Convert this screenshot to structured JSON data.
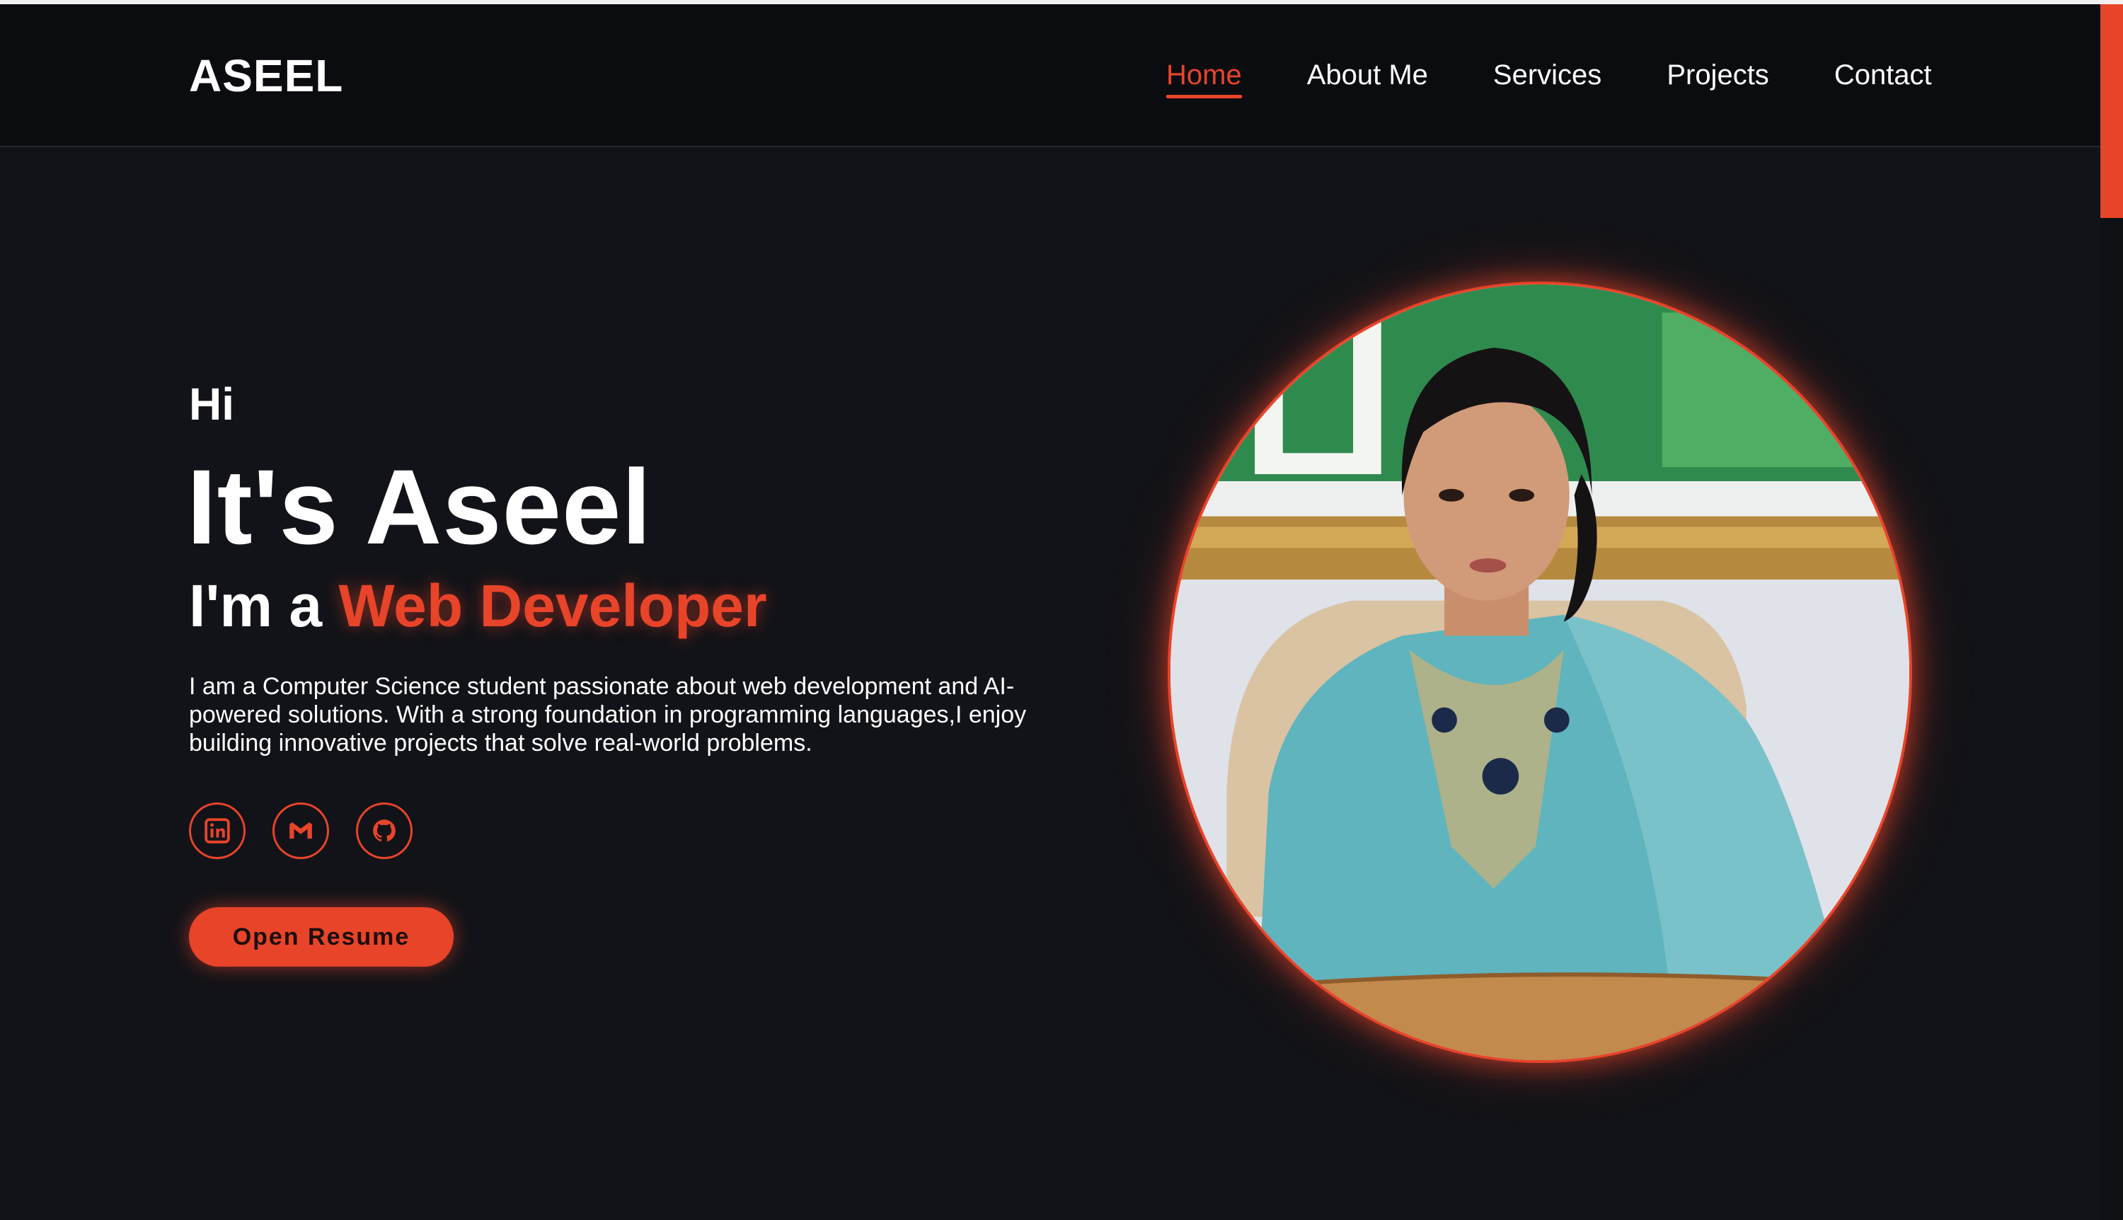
{
  "header": {
    "logo": "ASEEL",
    "nav": [
      {
        "label": "Home",
        "active": true
      },
      {
        "label": "About Me",
        "active": false
      },
      {
        "label": "Services",
        "active": false
      },
      {
        "label": "Projects",
        "active": false
      },
      {
        "label": "Contact",
        "active": false
      }
    ]
  },
  "hero": {
    "greeting": "Hi",
    "name": "It's Aseel",
    "role_prefix": "I'm a",
    "role_accent": "Web Developer",
    "bio": "I am a Computer Science student passionate about web development and AI-powered solutions. With a strong foundation in programming languages,I enjoy building innovative projects that solve real-world problems.",
    "socials": [
      {
        "name": "linkedin-icon"
      },
      {
        "name": "gmail-icon"
      },
      {
        "name": "github-icon"
      }
    ],
    "resume_button": "Open Resume"
  },
  "colors": {
    "accent": "#e8442a",
    "background": "#121318",
    "header": "#0b0c10"
  }
}
